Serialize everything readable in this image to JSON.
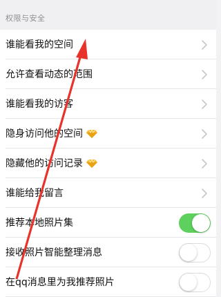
{
  "section": {
    "title": "权限与安全"
  },
  "rows": [
    {
      "label": "谁能看我的空间",
      "control": "chevron"
    },
    {
      "label": "允许查看动态的范围",
      "control": "chevron"
    },
    {
      "label": "谁能看我的访客",
      "control": "chevron"
    },
    {
      "label": "隐身访问他的空间",
      "control": "chevron",
      "badge": "diamond-icon"
    },
    {
      "label": "隐藏他的访问记录",
      "control": "chevron",
      "badge": "diamond-icon"
    },
    {
      "label": "谁能给我留言",
      "control": "chevron"
    },
    {
      "label": "推荐本地照片集",
      "control": "toggle",
      "state": "on"
    },
    {
      "label": "接收照片智能整理消息",
      "control": "toggle",
      "state": "off"
    },
    {
      "label": "在qq消息里为我推荐照片",
      "control": "toggle",
      "state": "off"
    }
  ],
  "colors": {
    "toggle_on": "#5ed05e",
    "annotation": "#e8332a",
    "diamond": "#f5b82e"
  }
}
